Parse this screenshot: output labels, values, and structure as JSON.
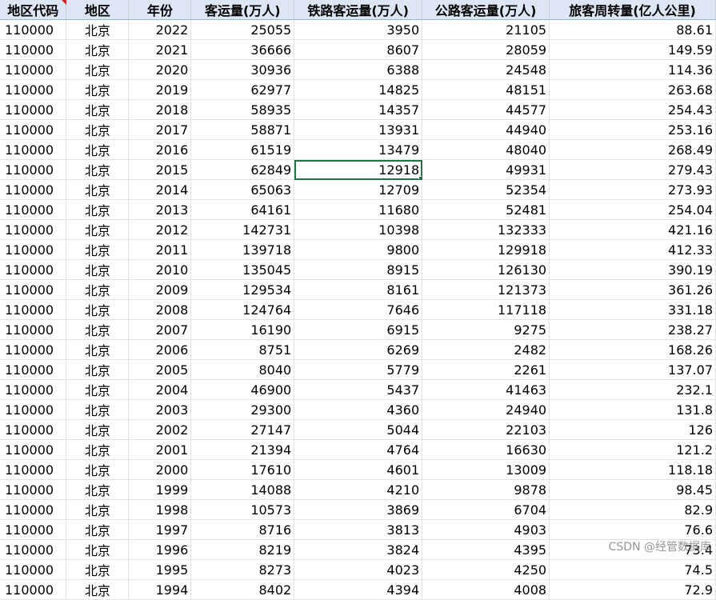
{
  "columns": [
    "地区代码",
    "地区",
    "年份",
    "客运量(万人)",
    "铁路客运量(万人)",
    "公路客运量(万人)",
    "旅客周转量(亿人公里)"
  ],
  "rows": [
    [
      "110000",
      "北京",
      "2022",
      "25055",
      "3950",
      "21105",
      "88.61"
    ],
    [
      "110000",
      "北京",
      "2021",
      "36666",
      "8607",
      "28059",
      "149.59"
    ],
    [
      "110000",
      "北京",
      "2020",
      "30936",
      "6388",
      "24548",
      "114.36"
    ],
    [
      "110000",
      "北京",
      "2019",
      "62977",
      "14825",
      "48151",
      "263.68"
    ],
    [
      "110000",
      "北京",
      "2018",
      "58935",
      "14357",
      "44577",
      "254.43"
    ],
    [
      "110000",
      "北京",
      "2017",
      "58871",
      "13931",
      "44940",
      "253.16"
    ],
    [
      "110000",
      "北京",
      "2016",
      "61519",
      "13479",
      "48040",
      "268.49"
    ],
    [
      "110000",
      "北京",
      "2015",
      "62849",
      "12918",
      "49931",
      "279.43"
    ],
    [
      "110000",
      "北京",
      "2014",
      "65063",
      "12709",
      "52354",
      "273.93"
    ],
    [
      "110000",
      "北京",
      "2013",
      "64161",
      "11680",
      "52481",
      "254.04"
    ],
    [
      "110000",
      "北京",
      "2012",
      "142731",
      "10398",
      "132333",
      "421.16"
    ],
    [
      "110000",
      "北京",
      "2011",
      "139718",
      "9800",
      "129918",
      "412.33"
    ],
    [
      "110000",
      "北京",
      "2010",
      "135045",
      "8915",
      "126130",
      "390.19"
    ],
    [
      "110000",
      "北京",
      "2009",
      "129534",
      "8161",
      "121373",
      "361.26"
    ],
    [
      "110000",
      "北京",
      "2008",
      "124764",
      "7646",
      "117118",
      "331.18"
    ],
    [
      "110000",
      "北京",
      "2007",
      "16190",
      "6915",
      "9275",
      "238.27"
    ],
    [
      "110000",
      "北京",
      "2006",
      "8751",
      "6269",
      "2482",
      "168.26"
    ],
    [
      "110000",
      "北京",
      "2005",
      "8040",
      "5779",
      "2261",
      "137.07"
    ],
    [
      "110000",
      "北京",
      "2004",
      "46900",
      "5437",
      "41463",
      "232.1"
    ],
    [
      "110000",
      "北京",
      "2003",
      "29300",
      "4360",
      "24940",
      "131.8"
    ],
    [
      "110000",
      "北京",
      "2002",
      "27147",
      "5044",
      "22103",
      "126"
    ],
    [
      "110000",
      "北京",
      "2001",
      "21394",
      "4764",
      "16630",
      "121.2"
    ],
    [
      "110000",
      "北京",
      "2000",
      "17610",
      "4601",
      "13009",
      "118.18"
    ],
    [
      "110000",
      "北京",
      "1999",
      "14088",
      "4210",
      "9878",
      "98.45"
    ],
    [
      "110000",
      "北京",
      "1998",
      "10573",
      "3869",
      "6704",
      "82.9"
    ],
    [
      "110000",
      "北京",
      "1997",
      "8716",
      "3813",
      "4903",
      "76.6"
    ],
    [
      "110000",
      "北京",
      "1996",
      "8219",
      "3824",
      "4395",
      "73.4"
    ],
    [
      "110000",
      "北京",
      "1995",
      "8273",
      "4023",
      "4250",
      "74.5"
    ],
    [
      "110000",
      "北京",
      "1994",
      "8402",
      "4394",
      "4008",
      "72.9"
    ]
  ],
  "selected_cell": {
    "row": 7,
    "col": 4
  },
  "accent_color": "#217346",
  "header_bg": "#dce6f4",
  "watermark": "CSDN @经管数据库"
}
